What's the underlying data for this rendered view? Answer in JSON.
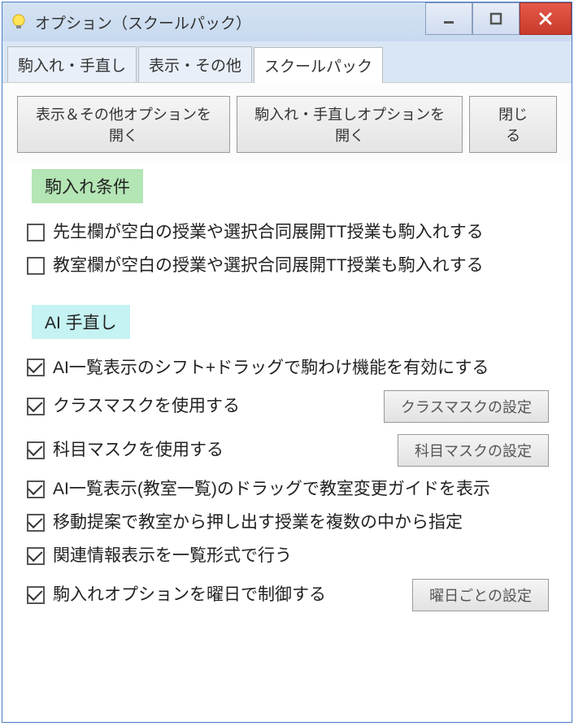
{
  "window": {
    "title": "オプション（スクールパック）"
  },
  "tabs": {
    "tab1": "駒入れ・手直し",
    "tab2": "表示・その他",
    "tab3": "スクールパック"
  },
  "toolbar": {
    "open_display": "表示＆その他オプションを開く",
    "open_koma": "駒入れ・手直しオプションを開く",
    "close": "閉じる"
  },
  "sections": {
    "koma_header": "駒入れ条件",
    "ai_header": "AI 手直し"
  },
  "options": {
    "teacher_blank": "先生欄が空白の授業や選択合同展開TT授業も駒入れする",
    "room_blank": "教室欄が空白の授業や選択合同展開TT授業も駒入れする",
    "ai_shift_drag": "AI一覧表示のシフト+ドラッグで駒わけ機能を有効にする",
    "class_mask": "クラスマスクを使用する",
    "subject_mask": "科目マスクを使用する",
    "ai_room_drag": "AI一覧表示(教室一覧)のドラッグで教室変更ガイドを表示",
    "move_suggest": "移動提案で教室から押し出す授業を複数の中から指定",
    "related_list": "関連情報表示を一覧形式で行う",
    "koma_weekday": "駒入れオプションを曜日で制御する"
  },
  "buttons": {
    "class_mask_config": "クラスマスクの設定",
    "subject_mask_config": "科目マスクの設定",
    "weekday_config": "曜日ごとの設定"
  }
}
